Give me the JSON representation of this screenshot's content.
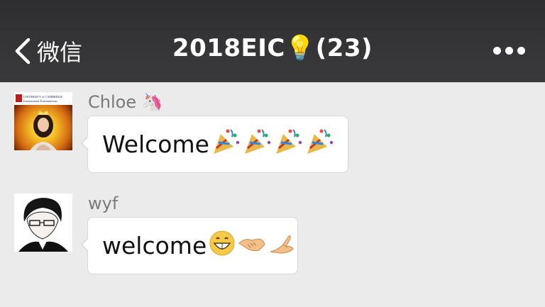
{
  "header": {
    "back_label": "微信",
    "title": "2018EIC💡(23)"
  },
  "messages": [
    {
      "sender": "Chloe 🦄",
      "text": "Welcome",
      "emojis": [
        "party-popper",
        "party-popper",
        "party-popper",
        "party-popper"
      ],
      "avatar_logo_line1": "UNIVERSITY of CAMBRIDGE",
      "avatar_logo_line2": "International Examinations"
    },
    {
      "sender": "wyf",
      "text": "welcome",
      "emojis": [
        "grinning-face",
        "handshake",
        "pinching-hand"
      ]
    }
  ],
  "colors": {
    "navbar": "#333335",
    "background": "#ebebeb",
    "bubble": "#ffffff",
    "sender_text": "#7a7a7a"
  }
}
